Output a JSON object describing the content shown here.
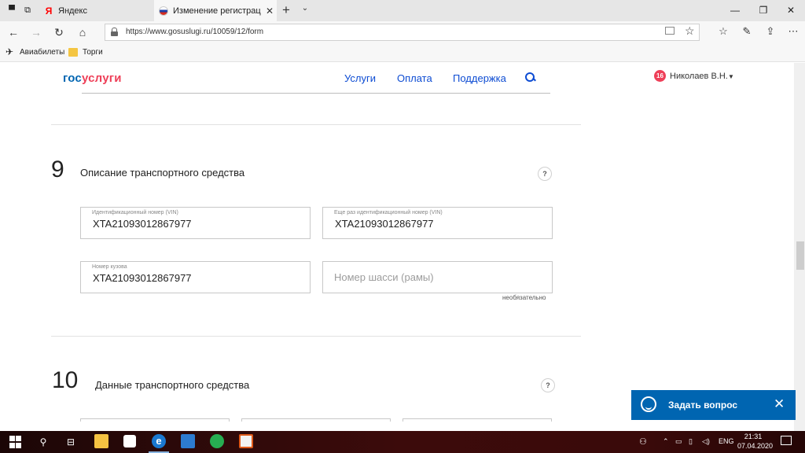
{
  "browser": {
    "tabs": [
      {
        "title": "Яндекс",
        "favicon": "yandex-icon"
      },
      {
        "title": "Изменение регистрац",
        "favicon": "russia-flag-icon",
        "active": true
      }
    ],
    "url": "https://www.gosuslugi.ru/10059/12/form",
    "bookmarks": [
      {
        "label": "Авиабилеты",
        "icon": "plane-icon"
      },
      {
        "label": "Торги",
        "icon": "folder-icon"
      }
    ]
  },
  "header": {
    "logo_part1": "гос",
    "logo_part2": "услуги",
    "nav": [
      "Услуги",
      "Оплата",
      "Поддержка"
    ],
    "notification_count": "16",
    "user_name": "Николаев В.Н."
  },
  "form": {
    "section9": {
      "number": "9",
      "title": "Описание транспортного средства",
      "help": "?",
      "fields": {
        "vin": {
          "label": "Идентификационный номер (VIN)",
          "value": "XTA21093012867977"
        },
        "vin_repeat": {
          "label": "Еще раз идентификационный номер (VIN)",
          "value": "XTA21093012867977"
        },
        "body_number": {
          "label": "Номер кузова",
          "value": "XTA21093012867977"
        },
        "chassis_number": {
          "placeholder": "Номер шасси (рамы)",
          "note": "необязательно"
        }
      }
    },
    "section10": {
      "number": "10",
      "title": "Данные транспортного средства",
      "help": "?"
    }
  },
  "chat": {
    "label": "Задать вопрос"
  },
  "taskbar": {
    "language": "ENG",
    "time": "21:31",
    "date": "07.04.2020"
  },
  "colors": {
    "brand_blue": "#0065b1",
    "brand_red": "#ee3f58",
    "link_blue": "#0d4cd3"
  }
}
